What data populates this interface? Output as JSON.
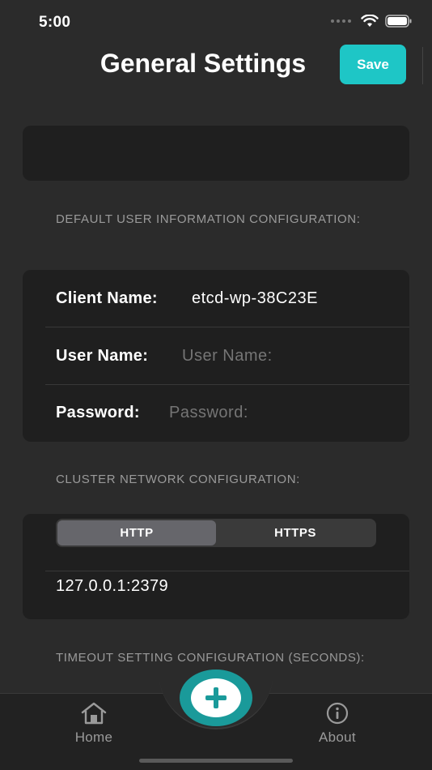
{
  "status_bar": {
    "time": "5:00"
  },
  "nav": {
    "title": "General Settings",
    "save_label": "Save"
  },
  "sections": {
    "user_info_header": "DEFAULT USER INFORMATION CONFIGURATION:",
    "cluster_header": "CLUSTER NETWORK CONFIGURATION:",
    "timeout_header": "TIMEOUT SETTING CONFIGURATION (SECONDS):"
  },
  "user_form": {
    "client_name_label": "Client Name:",
    "client_name_value": "etcd-wp-38C23E",
    "user_name_label": "User Name:",
    "user_name_placeholder": "User Name:",
    "password_label": "Password:",
    "password_placeholder": "Password:"
  },
  "cluster": {
    "protocol_options": [
      "HTTP",
      "HTTPS"
    ],
    "selected_protocol": "HTTP",
    "endpoint": "127.0.0.1:2379"
  },
  "tab_bar": {
    "home_label": "Home",
    "about_label": "About",
    "add_icon": "plus-icon"
  },
  "colors": {
    "accent": "#1ec6c6",
    "background": "#2b2b2b",
    "card": "#1f1f1f"
  }
}
